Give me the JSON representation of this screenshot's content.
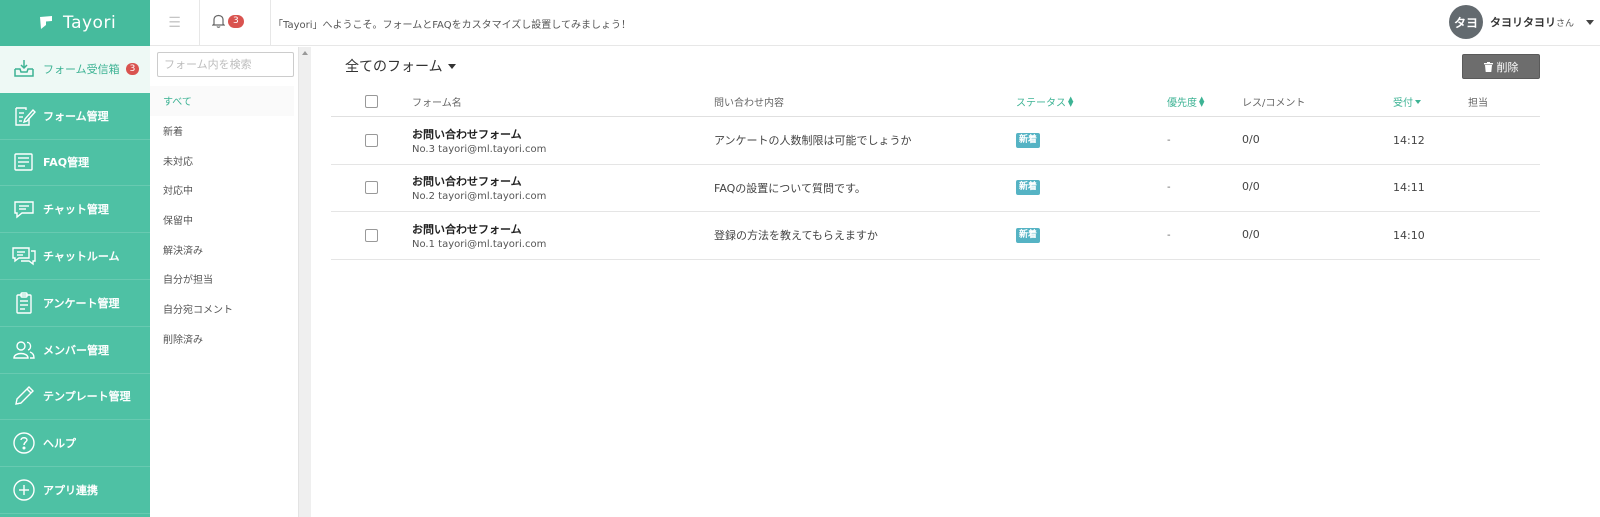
{
  "app": {
    "name": "Tayori"
  },
  "nav": {
    "items": [
      {
        "label": "フォーム受信箱",
        "icon": "inbox-icon",
        "badge": "3",
        "active": true
      },
      {
        "label": "フォーム管理",
        "icon": "form-edit-icon"
      },
      {
        "label": "FAQ管理",
        "icon": "faq-icon"
      },
      {
        "label": "チャット管理",
        "icon": "chat-icon"
      },
      {
        "label": "チャットルーム",
        "icon": "chat-room-icon"
      },
      {
        "label": "アンケート管理",
        "icon": "clipboard-icon"
      },
      {
        "label": "メンバー管理",
        "icon": "members-icon"
      },
      {
        "label": "テンプレート管理",
        "icon": "pencil-icon"
      },
      {
        "label": "ヘルプ",
        "icon": "help-icon"
      },
      {
        "label": "アプリ連携",
        "icon": "plus-circle-icon"
      }
    ]
  },
  "header": {
    "notification_count": "3",
    "welcome": "「Tayori」へようこそ。フォームとFAQをカスタマイズし設置してみましょう！",
    "user": {
      "avatar": "タヨ",
      "name": "タヨリタヨリ",
      "suffix": "さん"
    }
  },
  "filters": {
    "search_placeholder": "フォーム内を検索",
    "items": [
      "すべて",
      "新着",
      "未対応",
      "対応中",
      "保留中",
      "解決済み",
      "自分が担当",
      "自分宛コメント",
      "削除済み"
    ],
    "active_index": 0
  },
  "main": {
    "form_selector": "全てのフォーム",
    "delete_label": "削除",
    "columns": {
      "form": "フォーム名",
      "inquiry": "問い合わせ内容",
      "status": "ステータス",
      "priority": "優先度",
      "replies": "レス/コメント",
      "received": "受付",
      "assignee": "担当"
    },
    "rows": [
      {
        "form_name": "お問い合わせフォーム",
        "meta": "No.3 tayori@ml.tayori.com",
        "inquiry": "アンケートの人数制限は可能でしょうか",
        "status": "新着",
        "priority": "-",
        "replies": "0/0",
        "time": "14:12",
        "assignee": ""
      },
      {
        "form_name": "お問い合わせフォーム",
        "meta": "No.2 tayori@ml.tayori.com",
        "inquiry": "FAQの設置について質問です。",
        "status": "新着",
        "priority": "-",
        "replies": "0/0",
        "time": "14:11",
        "assignee": ""
      },
      {
        "form_name": "お問い合わせフォーム",
        "meta": "No.1 tayori@ml.tayori.com",
        "inquiry": "登録の方法を教えてもらえますか",
        "status": "新着",
        "priority": "-",
        "replies": "0/0",
        "time": "14:10",
        "assignee": ""
      }
    ]
  },
  "colors": {
    "brand": "#4ec1a4",
    "accent": "#3db394",
    "badge": "#d9534f",
    "status_new": "#55b3c4",
    "delete_button": "#6d6d6d"
  }
}
